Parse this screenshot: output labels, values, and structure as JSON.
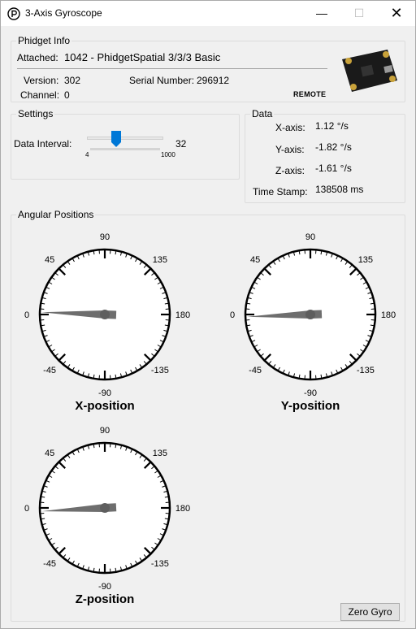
{
  "window": {
    "title": "3-Axis Gyroscope"
  },
  "phidget_info": {
    "group_label": "Phidget Info",
    "attached_label": "Attached:",
    "attached_value": "1042 - PhidgetSpatial 3/3/3 Basic",
    "version_label": "Version:",
    "version_value": "302",
    "serial_label": "Serial Number:",
    "serial_value": "296912",
    "channel_label": "Channel:",
    "channel_value": "0",
    "remote_label": "REMOTE"
  },
  "settings": {
    "group_label": "Settings",
    "interval_label": "Data Interval:",
    "interval_value": "32",
    "slider_min": "4",
    "slider_max": "1000"
  },
  "data": {
    "group_label": "Data",
    "x_label": "X-axis:",
    "x_value": "1.12 °/s",
    "y_label": "Y-axis:",
    "y_value": "-1.82 °/s",
    "z_label": "Z-axis:",
    "z_value": "-1.61 °/s",
    "ts_label": "Time Stamp:",
    "ts_value": "138508 ms"
  },
  "angular": {
    "group_label": "Angular Positions",
    "dial_labels": {
      "top": "90",
      "upper_left": "45",
      "upper_right": "135",
      "left": "0",
      "right": "180",
      "lower_left": "-45",
      "lower_right": "-135",
      "bottom": "-90"
    },
    "gauges": [
      {
        "title": "X-position",
        "angle": -2
      },
      {
        "title": "Y-position",
        "angle": 2
      },
      {
        "title": "Z-position",
        "angle": 3
      }
    ]
  },
  "buttons": {
    "zero_gyro": "Zero Gyro"
  },
  "colors": {
    "slider_thumb": "#0078d7",
    "needle": "#6e6e6e"
  }
}
